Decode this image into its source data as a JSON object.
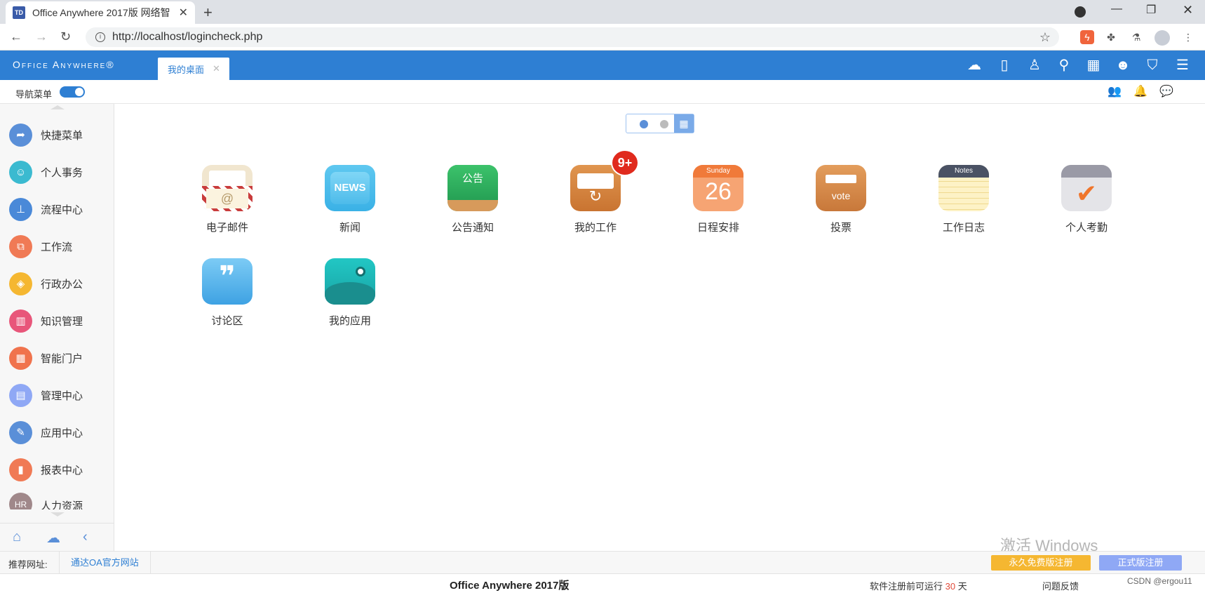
{
  "browser": {
    "tab_title": "Office Anywhere 2017版 网络智",
    "favicon_text": "TD",
    "url": "http://localhost/logincheck.php"
  },
  "header": {
    "logo": "Office Anywhere®",
    "tab_label": "我的桌面",
    "icons": [
      "cloud-icon",
      "mobile-icon",
      "user-icon",
      "search-icon",
      "apps-icon",
      "chat-bubble-icon",
      "shirt-icon",
      "menu-icon"
    ]
  },
  "subbar": {
    "nav_menu_label": "导航菜单",
    "nav_menu_enabled": true
  },
  "sidebar": {
    "items": [
      {
        "label": "快捷菜单",
        "color": "#5a8fd8",
        "glyph": "➦"
      },
      {
        "label": "个人事务",
        "color": "#3bbad0",
        "glyph": "👤"
      },
      {
        "label": "流程中心",
        "color": "#4a89d8",
        "glyph": "⊥"
      },
      {
        "label": "工作流",
        "color": "#f07a55",
        "glyph": "⧉"
      },
      {
        "label": "行政办公",
        "color": "#f5b731",
        "glyph": "◈"
      },
      {
        "label": "知识管理",
        "color": "#e8567a",
        "glyph": "📖"
      },
      {
        "label": "智能门户",
        "color": "#f0734d",
        "glyph": "▦"
      },
      {
        "label": "管理中心",
        "color": "#8fa8f5",
        "glyph": "▤"
      },
      {
        "label": "应用中心",
        "color": "#5a8fd8",
        "glyph": "✎"
      },
      {
        "label": "报表中心",
        "color": "#f07a55",
        "glyph": "▮"
      },
      {
        "label": "人力资源",
        "color": "#a0888a",
        "glyph": "HR"
      }
    ]
  },
  "desktop": {
    "page_indicator": {
      "pages": 2,
      "current": 1
    },
    "apps": [
      {
        "label": "电子邮件",
        "icon": "email-icon"
      },
      {
        "label": "新闻",
        "icon": "news-icon",
        "tile_text": "NEWS"
      },
      {
        "label": "公告通知",
        "icon": "notice-icon",
        "tile_text": "公告"
      },
      {
        "label": "我的工作",
        "icon": "my-work-icon",
        "badge": "9+"
      },
      {
        "label": "日程安排",
        "icon": "calendar-icon",
        "tile_header": "Sunday",
        "tile_text": "26"
      },
      {
        "label": "投票",
        "icon": "vote-icon",
        "tile_text": "vote"
      },
      {
        "label": "工作日志",
        "icon": "notes-icon",
        "tile_header": "Notes"
      },
      {
        "label": "个人考勤",
        "icon": "attendance-icon"
      },
      {
        "label": "讨论区",
        "icon": "forum-icon"
      },
      {
        "label": "我的应用",
        "icon": "my-apps-icon"
      }
    ]
  },
  "watermark": "激活 Windows",
  "linkbar": {
    "recommend_label": "推荐网址:",
    "recommend_link": "通达OA官方网站",
    "free_register": "永久免费版注册",
    "official_register": "正式版注册"
  },
  "statusbar": {
    "product": "Office Anywhere 2017版",
    "trial_prefix": "软件注册前可运行",
    "trial_days": "30",
    "trial_suffix": "天",
    "feedback": "问题反馈",
    "credit": "CSDN @ergou11"
  }
}
